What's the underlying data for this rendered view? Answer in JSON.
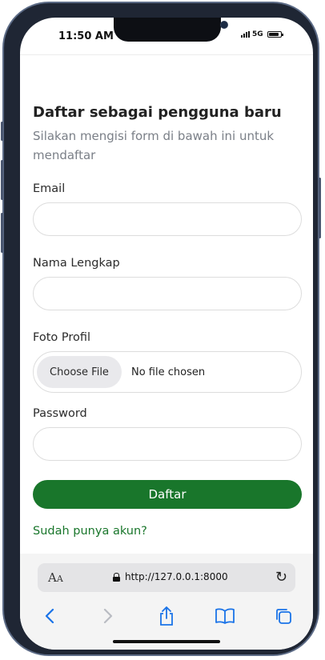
{
  "status": {
    "time": "11:50 AM",
    "network": "5G"
  },
  "form": {
    "title": "Daftar sebagai pengguna baru",
    "subtitle": "Silakan mengisi form di bawah ini untuk mendaftar",
    "email_label": "Email",
    "email_value": "",
    "name_label": "Nama Lengkap",
    "name_value": "",
    "photo_label": "Foto Profil",
    "choose_file_label": "Choose File",
    "file_status": "No file chosen",
    "password_label": "Password",
    "password_value": "",
    "submit_label": "Daftar",
    "login_link": "Sudah punya akun?"
  },
  "browser": {
    "aa_large": "A",
    "aa_small": "A",
    "url": "http://127.0.0.1:8000",
    "icons": [
      "text-size-icon",
      "lock-icon",
      "reload-icon",
      "back-icon",
      "forward-icon",
      "share-icon",
      "bookmarks-icon",
      "tabs-icon"
    ]
  },
  "colors": {
    "primary": "#19762b",
    "text_muted": "#7a7f87",
    "link": "#19762b",
    "field_border": "#dddddd"
  }
}
